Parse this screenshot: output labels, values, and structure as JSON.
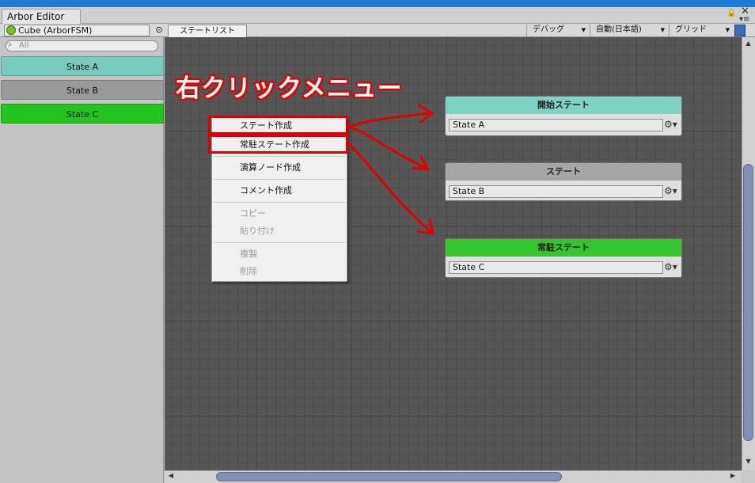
{
  "window": {
    "tab_label": "Arbor Editor",
    "lock_icon": "lock-icon",
    "close_icon": "close-icon",
    "menu_icon": "menu-icon"
  },
  "toolbar": {
    "fsm_name": "Cube (ArborFSM)",
    "state_list_tab": "ステートリスト",
    "debug_dropdown": "デバッグ",
    "language_dropdown": "自動(日本語)",
    "grid_dropdown": "グリッド"
  },
  "sidebar": {
    "search_placeholder": "All",
    "items": [
      {
        "label": "State A",
        "color": "#76cbbd"
      },
      {
        "label": "State B",
        "color": "#9a9a9a"
      },
      {
        "label": "State C",
        "color": "#24c41e"
      }
    ]
  },
  "annotation": {
    "title": "右クリックメニュー",
    "color": "#e00000"
  },
  "context_menu": {
    "items": [
      {
        "label": "ステート作成",
        "enabled": true
      },
      {
        "label": "常駐ステート作成",
        "enabled": true
      },
      {
        "label": "演算ノード作成",
        "enabled": true
      },
      {
        "label": "コメント作成",
        "enabled": true
      },
      {
        "label": "コピー",
        "enabled": false
      },
      {
        "label": "貼り付け",
        "enabled": false
      },
      {
        "label": "複製",
        "enabled": false
      },
      {
        "label": "削除",
        "enabled": false
      }
    ]
  },
  "nodes": [
    {
      "header": "開始ステート",
      "name": "State A",
      "color": "#80d2c4"
    },
    {
      "header": "ステート",
      "name": "State B",
      "color": "#a6a6a6"
    },
    {
      "header": "常駐ステート",
      "name": "State C",
      "color": "#36c52e"
    }
  ]
}
